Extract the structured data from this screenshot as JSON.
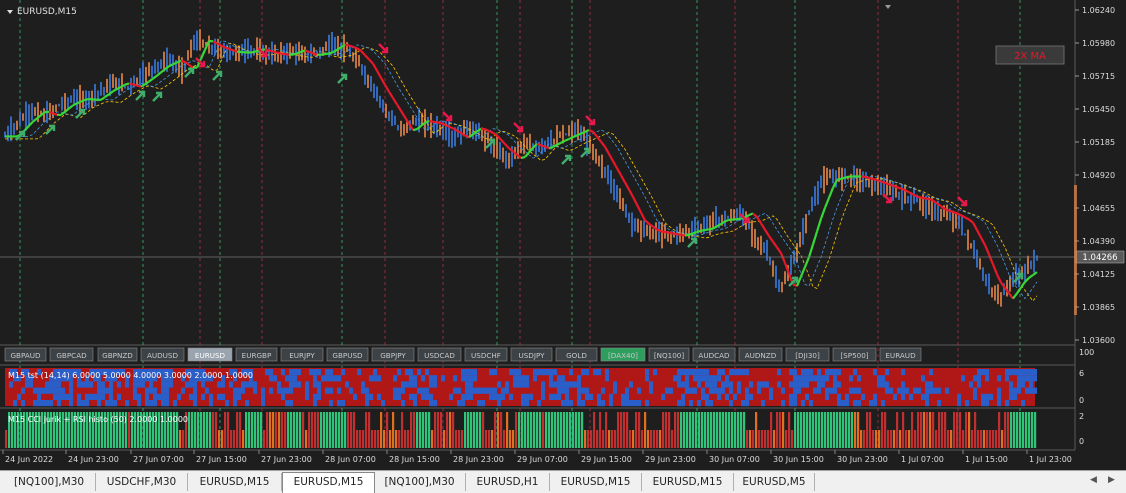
{
  "window": {
    "symbol_title": "EURUSD,M15",
    "indicator_label": "2X MA"
  },
  "price_axis": {
    "labels": [
      "1.06240",
      "1.05980",
      "1.05715",
      "1.05450",
      "1.05185",
      "1.04920",
      "1.04655",
      "1.04390",
      "1.04125",
      "1.03865",
      "1.03600"
    ],
    "current_price": "1.04266",
    "ymin": 1.0354,
    "ymax": 1.0628
  },
  "symbol_buttons": [
    {
      "label": "GBPAUD",
      "active": false
    },
    {
      "label": "GBPCAD",
      "active": false
    },
    {
      "label": "GBPNZD",
      "active": false
    },
    {
      "label": "AUDUSD",
      "active": false
    },
    {
      "label": "EURUSD",
      "active": true
    },
    {
      "label": "EURGBP",
      "active": false
    },
    {
      "label": "EURJPY",
      "active": false
    },
    {
      "label": "GBPUSD",
      "active": false
    },
    {
      "label": "GBPJPY",
      "active": false
    },
    {
      "label": "USDCAD",
      "active": false
    },
    {
      "label": "USDCHF",
      "active": false
    },
    {
      "label": "USDJPY",
      "active": false
    },
    {
      "label": "GOLD",
      "active": false
    },
    {
      "label": "[DAX40]",
      "active": false,
      "highlight": true
    },
    {
      "label": "[NQ100]",
      "active": false
    },
    {
      "label": "AUDCAD",
      "active": false
    },
    {
      "label": "AUDNZD",
      "active": false
    },
    {
      "label": "[DJI30]",
      "active": false
    },
    {
      "label": "[SP500]",
      "active": false
    },
    {
      "label": "EURAUD",
      "active": false
    }
  ],
  "indicator1": {
    "label": "M15 tst (14,14) 6.0000 5.0000 4.0000 3.0000 2.0000 1.0000",
    "scale_top": "100",
    "axis": [
      "6",
      "0"
    ]
  },
  "indicator2": {
    "label": "M15  CCI jurik + RSI histo (50) 2.0000 1.0000",
    "axis": [
      "2",
      "0"
    ]
  },
  "time_axis": [
    "24 Jun 2022",
    "24 Jun 23:00",
    "27 Jun 07:00",
    "27 Jun 15:00",
    "27 Jun 23:00",
    "28 Jun 07:00",
    "28 Jun 15:00",
    "28 Jun 23:00",
    "29 Jun 07:00",
    "29 Jun 15:00",
    "29 Jun 23:00",
    "30 Jun 07:00",
    "30 Jun 15:00",
    "30 Jun 23:00",
    "1 Jul 07:00",
    "1 Jul 15:00",
    "1 Jul 23:00"
  ],
  "tabs": [
    {
      "label": "[NQ100],M30",
      "active": false
    },
    {
      "label": "USDCHF,M30",
      "active": false
    },
    {
      "label": "EURUSD,M15",
      "active": false
    },
    {
      "label": "EURUSD,M15",
      "active": true
    },
    {
      "label": "[NQ100],M30",
      "active": false
    },
    {
      "label": "EURUSD,H1",
      "active": false
    },
    {
      "label": "EURUSD,M15",
      "active": false
    },
    {
      "label": "EURUSD,M15",
      "active": false
    },
    {
      "label": "EURUSD,M5",
      "active": false
    }
  ],
  "tab_nav": {
    "left": "◀",
    "right": "▶"
  },
  "colors": {
    "bg": "#1e1e1e",
    "bull": "#3a7be0",
    "bear": "#e8894a",
    "ma_up": "#38d838",
    "ma_down": "#e8182a",
    "ma_dash": "#ffcc00",
    "buy_arrow": "#3fae6a",
    "sell_arrow": "#e8184a",
    "grid_green": "#3fd07a",
    "grid_red": "#d0304a",
    "ind_red": "#b01818",
    "ind_blue": "#2a5ec8",
    "histo_green": "#2ec47a",
    "histo_red": "#c03030",
    "histo_orange": "#e07020"
  },
  "price_path": [
    [
      0,
      1.0522
    ],
    [
      1,
      1.0534
    ],
    [
      2,
      1.0543
    ],
    [
      3,
      1.0539
    ],
    [
      4,
      1.0548
    ],
    [
      5,
      1.0553
    ],
    [
      6,
      1.0552
    ],
    [
      7,
      1.056
    ],
    [
      8,
      1.0566
    ],
    [
      9,
      1.0563
    ],
    [
      10,
      1.0571
    ],
    [
      11,
      1.058
    ],
    [
      12,
      1.0585
    ],
    [
      13,
      1.0577
    ],
    [
      14,
      1.0602
    ],
    [
      15,
      1.0596
    ],
    [
      16,
      1.0592
    ],
    [
      17,
      1.0591
    ],
    [
      18,
      1.0594
    ],
    [
      19,
      1.0591
    ],
    [
      20,
      1.0589
    ],
    [
      21,
      1.0593
    ],
    [
      22,
      1.0589
    ],
    [
      23,
      1.0591
    ],
    [
      24,
      1.0598
    ],
    [
      25,
      1.0594
    ],
    [
      26,
      1.0582
    ],
    [
      27,
      1.0562
    ],
    [
      28,
      1.0544
    ],
    [
      29,
      1.0526
    ],
    [
      30,
      1.0535
    ],
    [
      31,
      1.0533
    ],
    [
      32,
      1.0528
    ],
    [
      33,
      1.0521
    ],
    [
      34,
      1.0529
    ],
    [
      35,
      1.0524
    ],
    [
      36,
      1.0512
    ],
    [
      37,
      1.0503
    ],
    [
      38,
      1.0516
    ],
    [
      39,
      1.0512
    ],
    [
      40,
      1.0518
    ],
    [
      41,
      1.0523
    ],
    [
      42,
      1.0528
    ],
    [
      43,
      1.0514
    ],
    [
      44,
      1.0494
    ],
    [
      45,
      1.0474
    ],
    [
      46,
      1.0452
    ],
    [
      47,
      1.0444
    ],
    [
      48,
      1.0442
    ],
    [
      49,
      1.044
    ],
    [
      50,
      1.0444
    ],
    [
      51,
      1.0446
    ],
    [
      52,
      1.0453
    ],
    [
      53,
      1.0454
    ],
    [
      54,
      1.0459
    ],
    [
      55,
      1.0441
    ],
    [
      56,
      1.0425
    ],
    [
      57,
      1.0395
    ],
    [
      58,
      1.0422
    ],
    [
      59,
      1.0458
    ],
    [
      60,
      1.0486
    ],
    [
      61,
      1.0489
    ],
    [
      62,
      1.0489
    ],
    [
      63,
      1.0486
    ],
    [
      64,
      1.0482
    ],
    [
      65,
      1.0478
    ],
    [
      66,
      1.0472
    ],
    [
      67,
      1.047
    ],
    [
      68,
      1.0462
    ],
    [
      69,
      1.0458
    ],
    [
      70,
      1.0452
    ],
    [
      71,
      1.0431
    ],
    [
      72,
      1.0403
    ],
    [
      73,
      1.0388
    ],
    [
      74,
      1.0404
    ],
    [
      75,
      1.0412
    ],
    [
      76,
      1.0426
    ]
  ]
}
